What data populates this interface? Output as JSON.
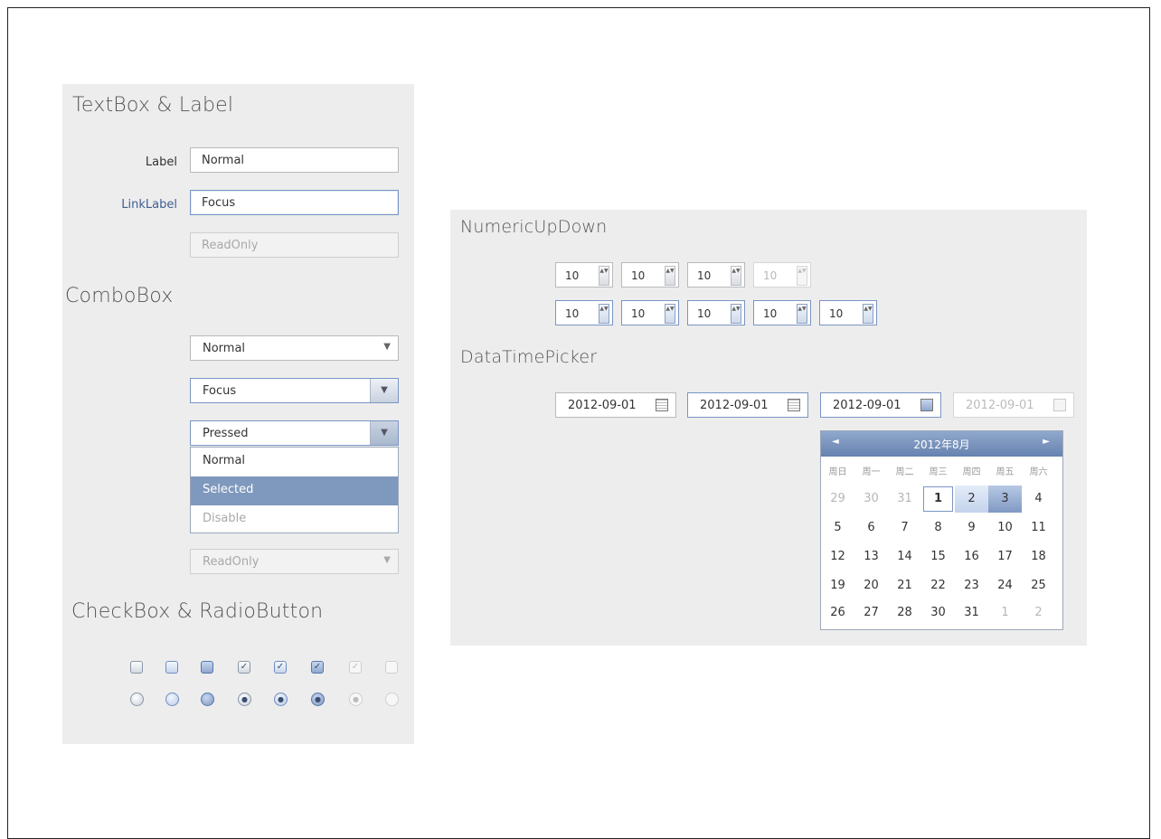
{
  "sections": {
    "textbox_title": "TextBox & Label",
    "combobox_title": "ComboBox",
    "checkbox_title": "CheckBox & RadioButton",
    "numeric_title": "NumericUpDown",
    "datetime_title": "DataTimePicker"
  },
  "textbox": {
    "label": "Label",
    "link_label": "LinkLabel",
    "normal_value": "Normal",
    "focus_value": "Focus",
    "readonly_value": "ReadOnly"
  },
  "combobox": {
    "normal_value": "Normal",
    "focus_value": "Focus",
    "pressed_value": "Pressed",
    "readonly_value": "ReadOnly",
    "items": [
      "Normal",
      "Selected",
      "Disable"
    ]
  },
  "checkbox": {
    "states": [
      "unchecked-normal",
      "unchecked-hover",
      "unchecked-pressed",
      "checked-normal",
      "checked-hover",
      "checked-pressed",
      "checked-disabled",
      "unchecked-disabled"
    ]
  },
  "numeric": {
    "row1": [
      "10",
      "10",
      "10",
      "10"
    ],
    "row2": [
      "10",
      "10",
      "10",
      "10",
      "10"
    ]
  },
  "datetime": {
    "values": [
      "2012-09-01",
      "2012-09-01",
      "2012-09-01",
      "2012-09-01"
    ]
  },
  "calendar": {
    "month_title": "2012年8月",
    "prev_icon": "◄",
    "next_icon": "►",
    "weekdays": [
      "周日",
      "周一",
      "周二",
      "周三",
      "周四",
      "周五",
      "周六"
    ],
    "weeks": [
      [
        "29",
        "30",
        "31",
        "1",
        "2",
        "3",
        "4"
      ],
      [
        "5",
        "6",
        "7",
        "8",
        "9",
        "10",
        "11"
      ],
      [
        "12",
        "13",
        "14",
        "15",
        "16",
        "17",
        "18"
      ],
      [
        "19",
        "20",
        "21",
        "22",
        "23",
        "24",
        "25"
      ],
      [
        "26",
        "27",
        "28",
        "30",
        "31",
        "1",
        "2"
      ]
    ]
  },
  "icons": {
    "dropdown_arrow": "▼",
    "spin": "▲▼",
    "calendar": "▦",
    "check": "✓",
    "radio_dot": "●"
  },
  "colors": {
    "accent": "#7a95c4",
    "selected_bg": "#7f98bd",
    "panel_bg": "#ededed",
    "link": "#3f5f93"
  }
}
